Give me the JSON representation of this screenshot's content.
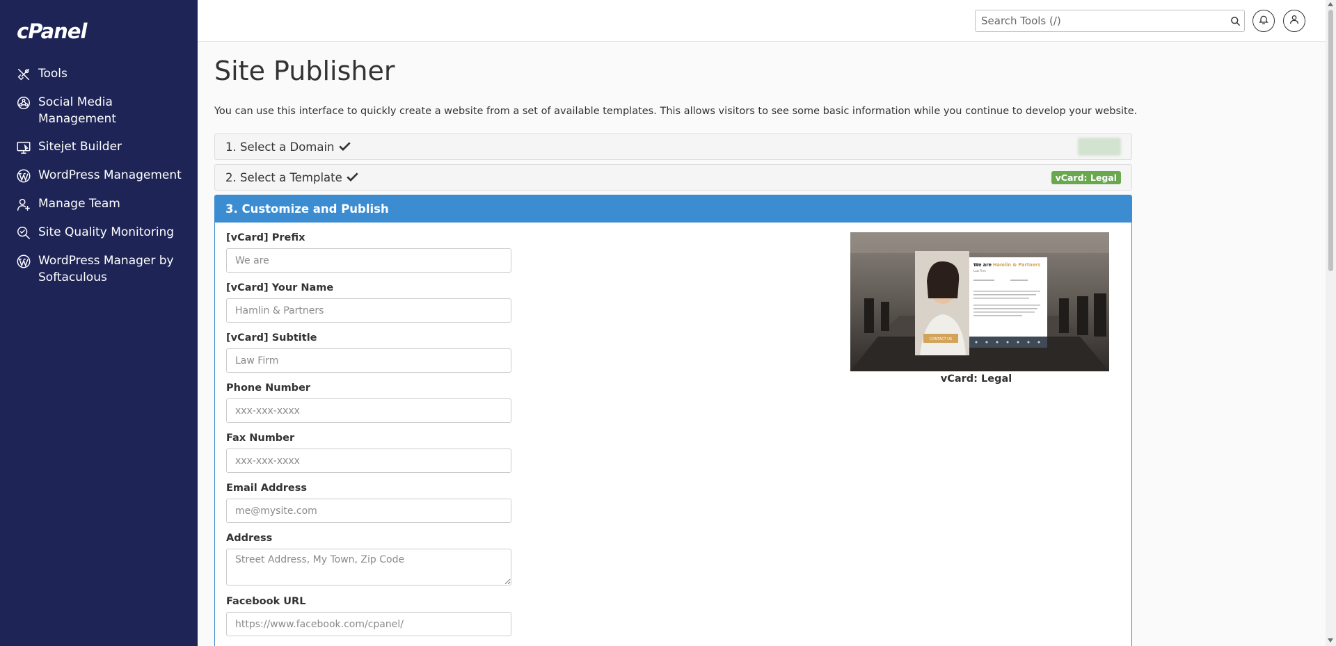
{
  "app": {
    "logo": "cPanel"
  },
  "sidebar": {
    "items": [
      {
        "label": "Tools",
        "icon": "tools-icon"
      },
      {
        "label": "Social Media Management",
        "icon": "social-media-icon"
      },
      {
        "label": "Sitejet Builder",
        "icon": "sitejet-icon"
      },
      {
        "label": "WordPress Management",
        "icon": "wordpress-icon"
      },
      {
        "label": "Manage Team",
        "icon": "manage-team-icon"
      },
      {
        "label": "Site Quality Monitoring",
        "icon": "site-quality-icon"
      },
      {
        "label": "WordPress Manager by Softaculous",
        "icon": "wordpress-icon"
      }
    ]
  },
  "header": {
    "search_placeholder": "Search Tools (/)"
  },
  "page": {
    "title": "Site Publisher",
    "description": "You can use this interface to quickly create a website from a set of available templates. This allows visitors to see some basic information while you continue to develop your website."
  },
  "steps": [
    {
      "label": "1. Select a Domain",
      "done": true
    },
    {
      "label": "2. Select a Template",
      "done": true,
      "badge": "vCard: Legal"
    },
    {
      "label": "3. Customize and Publish",
      "active": true
    }
  ],
  "form": {
    "fields": [
      {
        "label": "[vCard] Prefix",
        "placeholder": "We are"
      },
      {
        "label": "[vCard] Your Name",
        "placeholder": "Hamlin & Partners"
      },
      {
        "label": "[vCard] Subtitle",
        "placeholder": "Law Firm"
      },
      {
        "label": "Phone Number",
        "placeholder": "xxx-xxx-xxxx"
      },
      {
        "label": "Fax Number",
        "placeholder": "xxx-xxx-xxxx"
      },
      {
        "label": "Email Address",
        "placeholder": "me@mysite.com"
      },
      {
        "label": "Address",
        "placeholder": "Street Address, My Town, Zip Code"
      },
      {
        "label": "Facebook URL",
        "placeholder": "https://www.facebook.com/cpanel/"
      }
    ]
  },
  "preview": {
    "caption": "vCard: Legal",
    "card_heading_prefix": "We are",
    "card_heading_name": "Hamlin & Partners",
    "card_subtitle": "Law Firm",
    "button_label": "CONTACT US"
  },
  "colors": {
    "sidebar_bg": "#1e2556",
    "accent": "#3b8cd0",
    "badge_green": "#6aa84f",
    "preview_accent": "#d4a35a"
  }
}
